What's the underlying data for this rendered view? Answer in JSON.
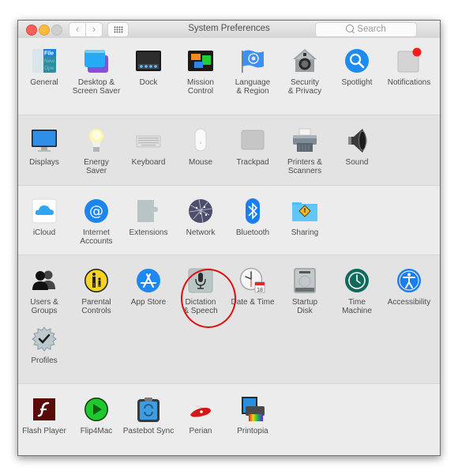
{
  "window": {
    "title": "System Preferences",
    "traffic_lights": [
      "close",
      "minimize",
      "zoom"
    ],
    "nav": {
      "back_icon": "chevron-left-icon",
      "forward_icon": "chevron-right-icon",
      "back_glyph": "‹",
      "forward_glyph": "›",
      "show_all_icon": "grid-icon"
    },
    "search": {
      "placeholder": "Search",
      "icon": "search-icon"
    }
  },
  "sections": [
    {
      "items": [
        {
          "label": "General",
          "icon": "general-icon"
        },
        {
          "label": "Desktop &\nScreen Saver",
          "icon": "desktop-screen-saver-icon"
        },
        {
          "label": "Dock",
          "icon": "dock-icon"
        },
        {
          "label": "Mission\nControl",
          "icon": "mission-control-icon"
        },
        {
          "label": "Language\n& Region",
          "icon": "language-region-flag-icon"
        },
        {
          "label": "Security\n& Privacy",
          "icon": "security-house-icon"
        },
        {
          "label": "Spotlight",
          "icon": "spotlight-magnifier-icon"
        },
        {
          "label": "Notifications",
          "icon": "notifications-icon"
        }
      ]
    },
    {
      "items": [
        {
          "label": "Displays",
          "icon": "display-monitor-icon"
        },
        {
          "label": "Energy\nSaver",
          "icon": "lightbulb-icon"
        },
        {
          "label": "Keyboard",
          "icon": "keyboard-icon"
        },
        {
          "label": "Mouse",
          "icon": "mouse-icon"
        },
        {
          "label": "Trackpad",
          "icon": "trackpad-icon"
        },
        {
          "label": "Printers &\nScanners",
          "icon": "printer-icon"
        },
        {
          "label": "Sound",
          "icon": "speaker-icon"
        }
      ]
    },
    {
      "items": [
        {
          "label": "iCloud",
          "icon": "icloud-icon"
        },
        {
          "label": "Internet\nAccounts",
          "icon": "at-sign-icon"
        },
        {
          "label": "Extensions",
          "icon": "puzzle-piece-icon"
        },
        {
          "label": "Network",
          "icon": "network-globe-icon"
        },
        {
          "label": "Bluetooth",
          "icon": "bluetooth-icon"
        },
        {
          "label": "Sharing",
          "icon": "sharing-folder-icon"
        }
      ]
    },
    {
      "items": [
        {
          "label": "Users &\nGroups",
          "icon": "users-silhouette-icon"
        },
        {
          "label": "Parental\nControls",
          "icon": "parental-controls-icon"
        },
        {
          "label": "App Store",
          "icon": "app-store-icon"
        },
        {
          "label": "Dictation\n& Speech",
          "icon": "microphone-icon",
          "highlighted": true
        },
        {
          "label": "Date & Time",
          "icon": "clock-calendar-icon",
          "calendar_day": "18"
        },
        {
          "label": "Startup\nDisk",
          "icon": "hard-disk-icon"
        },
        {
          "label": "Time\nMachine",
          "icon": "time-machine-icon"
        },
        {
          "label": "Accessibility",
          "icon": "accessibility-icon"
        },
        {
          "label": "Profiles",
          "icon": "profiles-badge-icon"
        }
      ]
    },
    {
      "items": [
        {
          "label": "Flash Player",
          "icon": "flash-player-icon"
        },
        {
          "label": "Flip4Mac",
          "icon": "flip4mac-play-icon"
        },
        {
          "label": "Pastebot Sync",
          "icon": "pastebot-clipboard-icon"
        },
        {
          "label": "Perian",
          "icon": "perian-knife-icon"
        },
        {
          "label": "Printopia",
          "icon": "printopia-icon"
        }
      ]
    }
  ],
  "annotation": {
    "highlight_color": "#e01010",
    "highlighted_item": "Dictation & Speech"
  }
}
